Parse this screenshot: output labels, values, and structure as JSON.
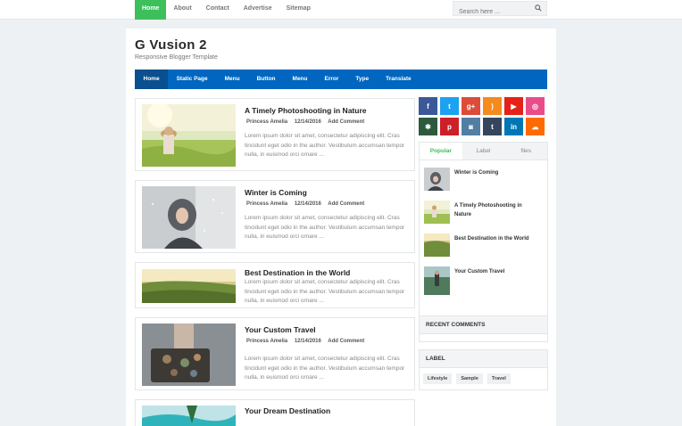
{
  "topnav": {
    "items": [
      {
        "label": "Home"
      },
      {
        "label": "About"
      },
      {
        "label": "Contact"
      },
      {
        "label": "Advertise"
      },
      {
        "label": "Sitemap"
      }
    ],
    "search_placeholder": "Search here ..."
  },
  "blog": {
    "title": "G Vusion 2",
    "subtitle": "Responsive Blogger Template"
  },
  "mainnav": {
    "items": [
      {
        "label": "Home"
      },
      {
        "label": "Static Page"
      },
      {
        "label": "Menu"
      },
      {
        "label": "Button"
      },
      {
        "label": "Menu"
      },
      {
        "label": "Error"
      },
      {
        "label": "Type"
      },
      {
        "label": "Translate"
      }
    ]
  },
  "posts": [
    {
      "title": "A Timely Photoshooting in Nature",
      "author": "Princess Amelia",
      "date": "12/14/2016",
      "comment": "Add Comment",
      "excerpt": "Lorem ipsum dolor sit amet, consectetur adipiscing elit. Cras tincidunt eget odio in the author. Vestibulum accumsan tempor nulla, in euismod orci ornare ..."
    },
    {
      "title": "Winter is Coming",
      "author": "Princess Amelia",
      "date": "12/14/2016",
      "comment": "Add Comment",
      "excerpt": "Lorem ipsum dolor sit amet, consectetur adipiscing elit. Cras tincidunt eget odio in the author. Vestibulum accumsan tempor nulla, in euismod orci ornare ..."
    },
    {
      "title": "Best Destination in the World",
      "excerpt": "Lorem ipsum dolor sit amet, consectetur adipiscing elit. Cras tincidunt eget odio in the author. Vestibulum accumsan tempor nulla, in euismod orci ornare ..."
    },
    {
      "title": "Your Custom Travel",
      "author": "Princess Amelia",
      "date": "12/14/2016",
      "comment": "Add Comment",
      "excerpt": "Lorem ipsum dolor sit amet, consectetur adipiscing elit. Cras tincidunt eget odio in the author. Vestibulum accumsan tempor nulla, in euismod orci ornare ..."
    },
    {
      "title": "Your Dream Destination"
    }
  ],
  "social": [
    {
      "icon": "facebook-icon",
      "glyph": "f",
      "color": "#3b5998"
    },
    {
      "icon": "twitter-icon",
      "glyph": "t",
      "color": "#1da1f2"
    },
    {
      "icon": "google-plus-icon",
      "glyph": "g+",
      "color": "#dd4b39"
    },
    {
      "icon": "rss-icon",
      "glyph": ")",
      "color": "#f58a1f"
    },
    {
      "icon": "youtube-icon",
      "glyph": "▶",
      "color": "#e62117"
    },
    {
      "icon": "dribbble-icon",
      "glyph": "◎",
      "color": "#ea4c89"
    },
    {
      "icon": "delicious-icon",
      "glyph": "✱",
      "color": "#2d5a3d"
    },
    {
      "icon": "pinterest-icon",
      "glyph": "p",
      "color": "#cb2027"
    },
    {
      "icon": "instagram-icon",
      "glyph": "◙",
      "color": "#517fa4"
    },
    {
      "icon": "tumblr-icon",
      "glyph": "t",
      "color": "#35465c"
    },
    {
      "icon": "linkedin-icon",
      "glyph": "in",
      "color": "#0077b5"
    },
    {
      "icon": "soundcloud-icon",
      "glyph": "☁",
      "color": "#ff6a00"
    }
  ],
  "tabs": [
    {
      "label": "Popular"
    },
    {
      "label": "Label"
    },
    {
      "label": "files"
    }
  ],
  "popular": [
    {
      "title": "Winter is Coming"
    },
    {
      "title": "A Timely Photoshooting in Nature"
    },
    {
      "title": "Best Destination in the World"
    },
    {
      "title": "Your Custom Travel"
    }
  ],
  "recent_comments": {
    "header": "RECENT COMMENTS"
  },
  "label_widget": {
    "header": "LABEL",
    "labels": [
      "Lifestyle",
      "Sample",
      "Travel"
    ]
  }
}
